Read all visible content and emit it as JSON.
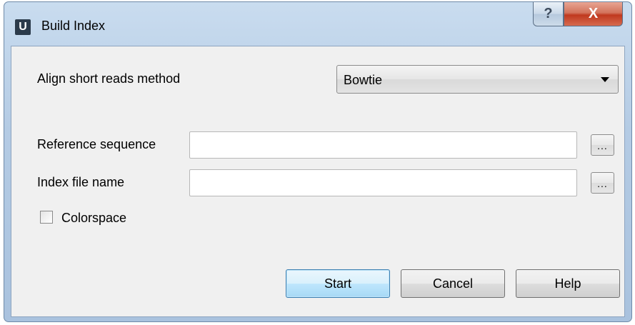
{
  "window": {
    "title": "Build Index",
    "logo_letter": "U",
    "help_glyph": "?",
    "close_glyph": "X"
  },
  "form": {
    "method_label": "Align short reads method",
    "method_value": "Bowtie",
    "reference_label": "Reference sequence",
    "reference_value": "",
    "index_label": "Index file name",
    "index_value": "",
    "browse_label": "...",
    "colorspace_label": "Colorspace",
    "colorspace_checked": false
  },
  "buttons": {
    "start": "Start",
    "cancel": "Cancel",
    "help": "Help"
  },
  "colors": {
    "close_button": "#c0391f",
    "default_button_border": "#3c7fb1",
    "client_background": "#f0f0f0"
  }
}
